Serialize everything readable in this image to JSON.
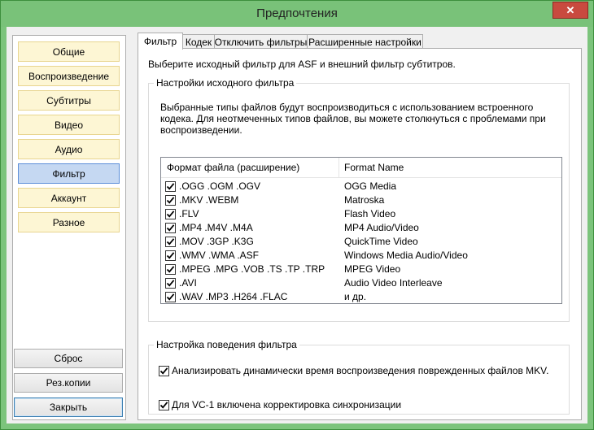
{
  "window": {
    "title": "Предпочтения",
    "close_glyph": "✕"
  },
  "sidebar": {
    "items": [
      {
        "label": "Общие"
      },
      {
        "label": "Воспроизведение"
      },
      {
        "label": "Субтитры"
      },
      {
        "label": "Видео"
      },
      {
        "label": "Аудио"
      },
      {
        "label": "Фильтр"
      },
      {
        "label": "Аккаунт"
      },
      {
        "label": "Разное"
      }
    ],
    "active_item": "Фильтр",
    "reset_label": "Сброс",
    "backup_label": "Рез.копии",
    "close_label": "Закрыть"
  },
  "tabs": [
    {
      "label": "Фильтр",
      "active": true
    },
    {
      "label": "Кодек"
    },
    {
      "label": "Отключить фильтры"
    },
    {
      "label": "Расширенные настройки"
    }
  ],
  "filter": {
    "intro": "Выберите исходный фильтр для ASF и внешний фильтр субтитров.",
    "source_group_title": "Настройки исходного фильтра",
    "description": "Выбранные типы файлов будут воспроизводиться с использованием встроенного кодека. Для неотмеченных типов файлов, вы можете столкнуться с проблемами при воспроизведении.",
    "columns": {
      "format": "Формат файла (расширение)",
      "name": "Format Name"
    },
    "rows": [
      {
        "format": ".OGG .OGM .OGV",
        "name": "OGG Media",
        "checked": true
      },
      {
        "format": ".MKV .WEBM",
        "name": "Matroska",
        "checked": true
      },
      {
        "format": ".FLV",
        "name": "Flash Video",
        "checked": true
      },
      {
        "format": ".MP4 .M4V .M4A",
        "name": "MP4 Audio/Video",
        "checked": true
      },
      {
        "format": ".MOV .3GP .K3G",
        "name": "QuickTime Video",
        "checked": true
      },
      {
        "format": ".WMV .WMA .ASF",
        "name": "Windows Media Audio/Video",
        "checked": true
      },
      {
        "format": ".MPEG .MPG .VOB .TS .TP .TRP",
        "name": "MPEG Video",
        "checked": true
      },
      {
        "format": ".AVI",
        "name": "Audio Video Interleave",
        "checked": true
      },
      {
        "format": ".WAV .MP3 .H264 .FLAC",
        "name": "и др.",
        "checked": true
      }
    ],
    "behavior_group_title": "Настройка поведения фильтра",
    "options": [
      {
        "label": "Анализировать динамически время воспроизведения поврежденных файлов MKV.",
        "checked": true
      },
      {
        "label": "Для VC-1 включена корректировка синхронизации",
        "checked": true
      }
    ]
  }
}
